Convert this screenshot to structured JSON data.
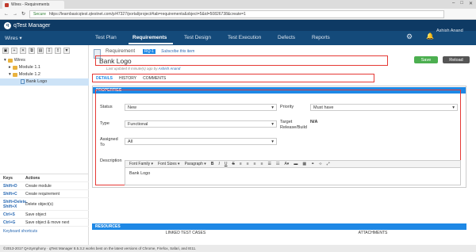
{
  "browser": {
    "tab_title": "Wires - Requirements",
    "secure_label": "Secure",
    "url": "https://learnbasicqtest.qtestnet.com/p/47327/portal/project#tab=requirements&object=5&id=50826738&create=1"
  },
  "app": {
    "name": "qTest Manager",
    "project": "Wires",
    "user": "Ashish Anand"
  },
  "nav": {
    "items": [
      "Test Plan",
      "Requirements",
      "Test Design",
      "Test Execution",
      "Defects",
      "Reports"
    ],
    "active": "Requirements"
  },
  "tree": {
    "root": "Wires",
    "modules": [
      "Module 1.1",
      "Module 1.2"
    ],
    "selected": "Bank Logo"
  },
  "shortcuts": {
    "header_keys": "Keys",
    "header_actions": "Actions",
    "rows": [
      {
        "key": "Shift+D",
        "action": "Create module"
      },
      {
        "key": "Shift+C",
        "action": "Create requirement"
      },
      {
        "key": "Shift+Delete, Shift+X",
        "action": "Delete object(s)"
      },
      {
        "key": "Ctrl+S",
        "action": "Save object"
      },
      {
        "key": "Ctrl+G",
        "action": "Save object & move next"
      }
    ],
    "link": "Keyboard shortcuts"
  },
  "requirement": {
    "label": "Requirement",
    "id": "RQ-1",
    "subscribe": "Subscribe this item",
    "title": "Bank Logo",
    "updated_text": "Last updated 8 minute(s) ago by",
    "updated_by": "Ashish Anand"
  },
  "buttons": {
    "save": "Save",
    "reload": "Reload"
  },
  "tabs": [
    "DETAILS",
    "HISTORY",
    "COMMENTS"
  ],
  "properties": {
    "header": "PROPERTIES",
    "status_label": "Status",
    "status_value": "New",
    "priority_label": "Priority",
    "priority_value": "Must have",
    "type_label": "Type",
    "type_value": "Functional",
    "target_label": "Target Release/Build",
    "target_value": "N/A",
    "assigned_label": "Assigned To",
    "assigned_value": "All",
    "description_label": "Description",
    "description_value": "Bank Logo"
  },
  "editor": {
    "font_family": "Font Family",
    "font_sizes": "Font Sizes",
    "paragraph": "Paragraph"
  },
  "resources": {
    "header": "RESOURCES",
    "col1": "LINKED TEST CASES",
    "col2": "ATTACHMENTS"
  },
  "footer": "©2013-2017 QASymphony · qTest Manager 8.5.3.2 works best on the latest versions of Chrome, Firefox, Safari, and IE11."
}
